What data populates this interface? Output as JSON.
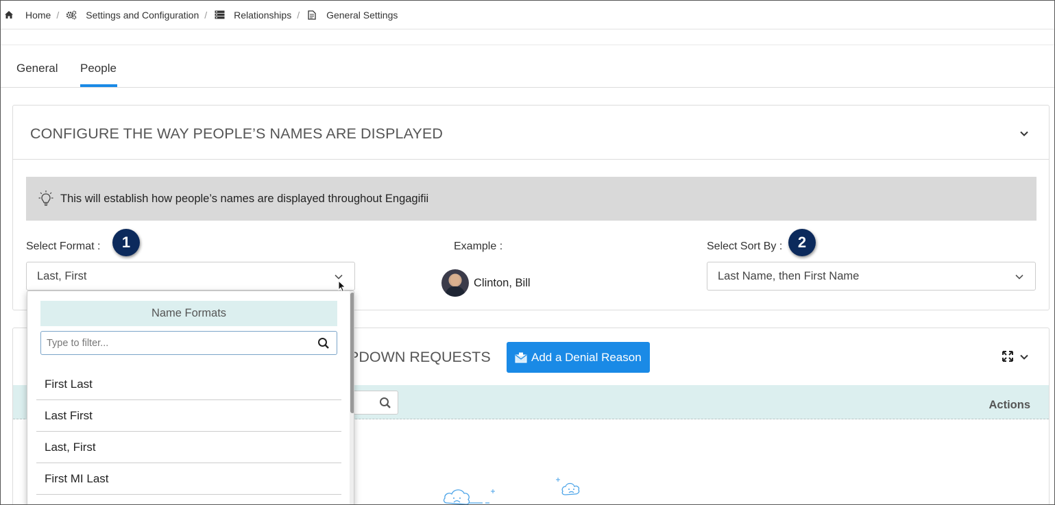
{
  "breadcrumb": {
    "items": [
      {
        "label": "Home",
        "icon": "home-icon"
      },
      {
        "label": "Settings and Configuration",
        "icon": "gears-icon"
      },
      {
        "label": "Relationships",
        "icon": "server-icon"
      },
      {
        "label": "General Settings",
        "icon": "document-icon"
      }
    ],
    "separator": "/"
  },
  "tabs": [
    {
      "label": "General",
      "active": false
    },
    {
      "label": "People",
      "active": true
    }
  ],
  "name_config": {
    "title": "CONFIGURE THE WAY PEOPLE’S NAMES ARE DISPLAYED",
    "info": "This will establish how people’s names are displayed throughout Engagifii",
    "format_label": "Select Format :",
    "format_value": "Last, First",
    "example_label": "Example :",
    "example_name": "Clinton, Bill",
    "sort_label": "Select Sort By :",
    "sort_value": "Last Name, then First Name",
    "badge_1": "1",
    "badge_2": "2"
  },
  "denial_card": {
    "title_partial": "PDOWN REQUESTS",
    "add_button": "Add a Denial Reason",
    "actions_header": "Actions"
  },
  "dropdown": {
    "header": "Name Formats",
    "filter_placeholder": "Type to filter...",
    "options": [
      "First Last",
      "Last First",
      "Last, First",
      "First MI Last"
    ]
  },
  "colors": {
    "accent": "#1a8ae6",
    "badge": "#0c2a5c",
    "table_header": "#dcefef",
    "info_bar": "#d9d9d9"
  }
}
